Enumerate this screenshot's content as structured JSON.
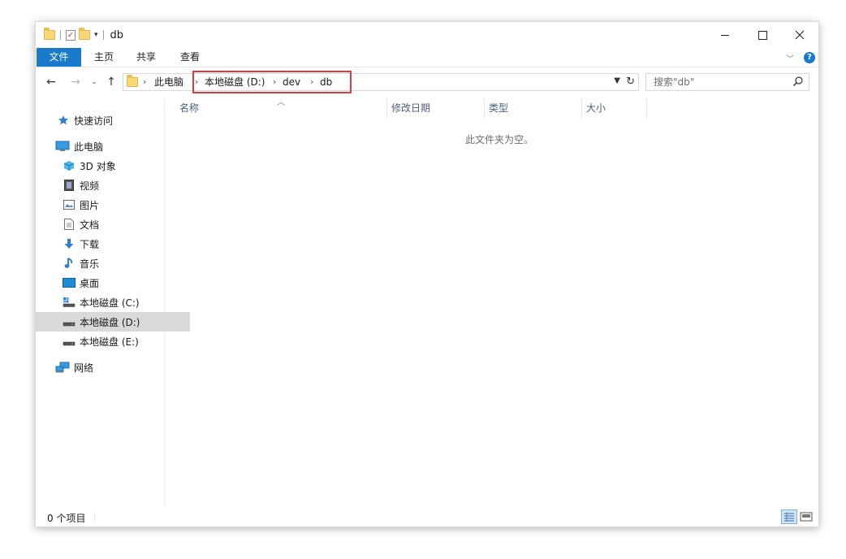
{
  "window": {
    "title": "db"
  },
  "ribbon": {
    "tabs": [
      "文件",
      "主页",
      "共享",
      "查看"
    ]
  },
  "address": {
    "crumbs": [
      "此电脑",
      "本地磁盘 (D:)",
      "dev",
      "db"
    ]
  },
  "search": {
    "placeholder": "搜索\"db\""
  },
  "sidebar": {
    "quick_access": "快速访问",
    "this_pc": "此电脑",
    "items": [
      "3D 对象",
      "视频",
      "图片",
      "文档",
      "下载",
      "音乐",
      "桌面",
      "本地磁盘 (C:)",
      "本地磁盘 (D:)",
      "本地磁盘 (E:)"
    ],
    "network": "网络",
    "selected": "本地磁盘 (D:)"
  },
  "columns": [
    "名称",
    "修改日期",
    "类型",
    "大小"
  ],
  "content": {
    "empty_message": "此文件夹为空。"
  },
  "status": {
    "item_count": "0 个项目"
  },
  "colors": {
    "accent": "#1979ca",
    "highlight_box": "#e0393e",
    "header_text": "#4c607a"
  }
}
